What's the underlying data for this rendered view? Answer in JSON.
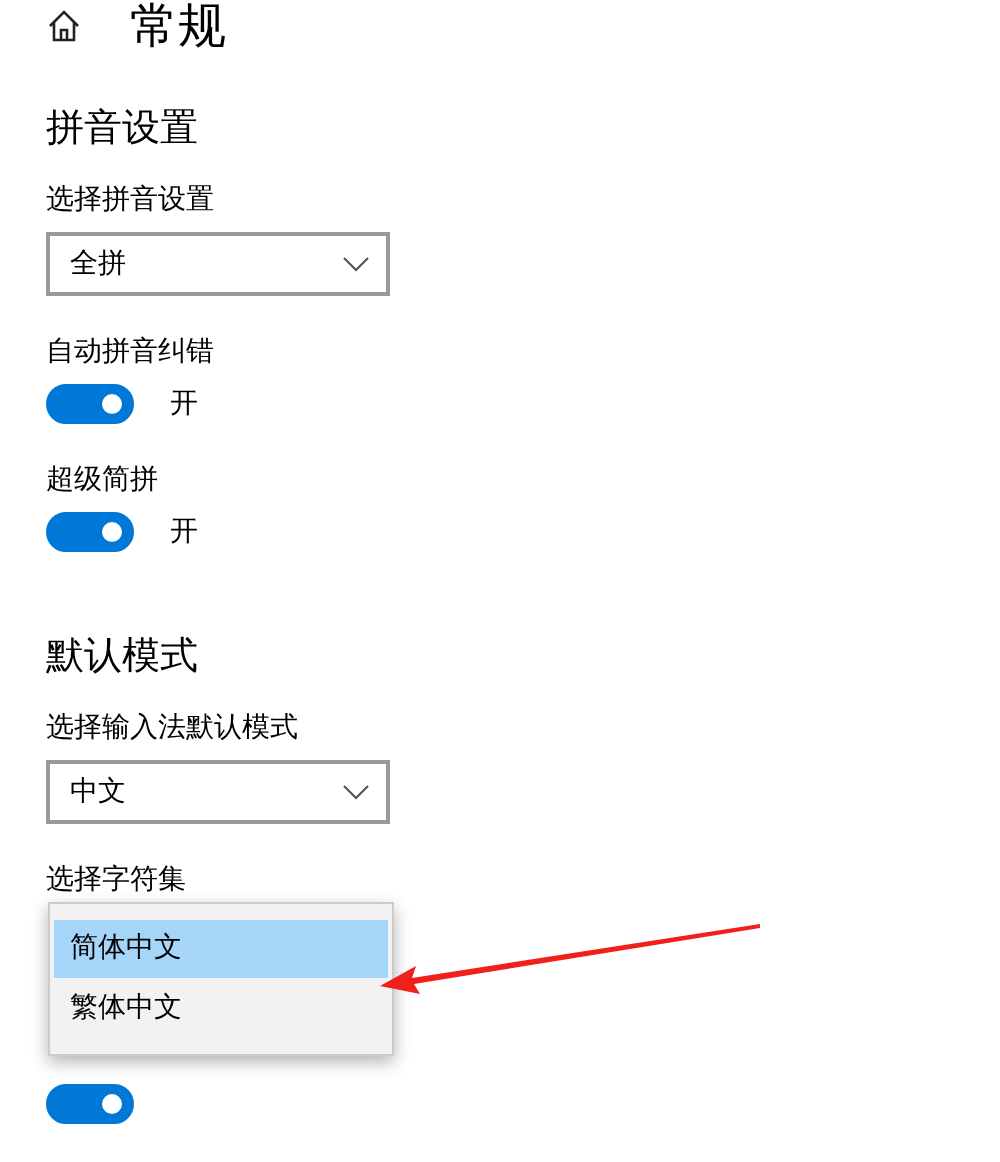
{
  "page": {
    "title": "常规"
  },
  "sections": [
    {
      "heading": "拼音设置",
      "items": [
        {
          "kind": "dropdown",
          "label": "选择拼音设置",
          "value": "全拼"
        },
        {
          "kind": "toggle",
          "label": "自动拼音纠错",
          "on": true,
          "state_text": "开"
        },
        {
          "kind": "toggle",
          "label": "超级简拼",
          "on": true,
          "state_text": "开"
        }
      ]
    },
    {
      "heading": "默认模式",
      "items": [
        {
          "kind": "dropdown",
          "label": "选择输入法默认模式",
          "value": "中文"
        },
        {
          "kind": "open_dropdown",
          "label": "选择字符集",
          "options": [
            {
              "label": "简体中文",
              "selected": true
            },
            {
              "label": "繁体中文",
              "selected": false
            }
          ]
        },
        {
          "kind": "toggle",
          "on": true
        }
      ]
    }
  ]
}
